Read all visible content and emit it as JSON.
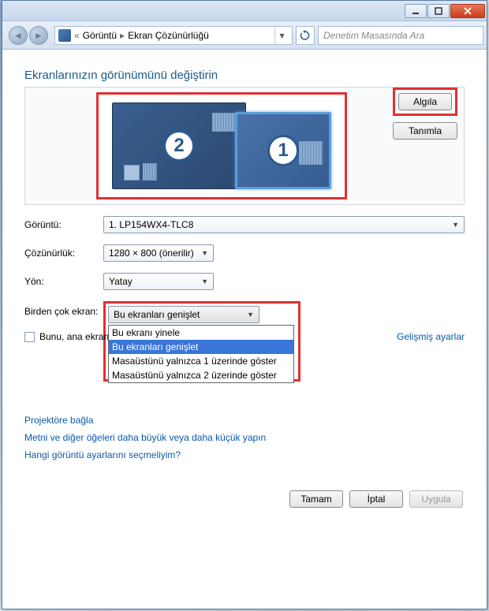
{
  "breadcrumb": {
    "item1": "Görüntü",
    "item2": "Ekran Çözünürlüğü"
  },
  "search": {
    "placeholder": "Denetim Masasında Ara"
  },
  "page": {
    "title": "Ekranlarınızın görünümünü değiştirin"
  },
  "monitors": {
    "num1": "1",
    "num2": "2"
  },
  "buttons": {
    "detect": "Algıla",
    "identify": "Tanımla",
    "ok": "Tamam",
    "cancel": "İptal",
    "apply": "Uygula"
  },
  "labels": {
    "display": "Görüntü:",
    "resolution": "Çözünürlük:",
    "orientation": "Yön:",
    "multiple": "Birden çok ekran:",
    "primary": "Bunu, ana ekran",
    "advanced": "Gelişmiş ayarlar"
  },
  "selects": {
    "display_value": "1. LP154WX4-TLC8",
    "resolution_value": "1280 × 800 (önerilir)",
    "orientation_value": "Yatay",
    "multiple_value": "Bu ekranları genişlet"
  },
  "dropdown": {
    "opt0": "Bu ekranı yinele",
    "opt1": "Bu ekranları genişlet",
    "opt2": "Masaüstünü yalnızca 1 üzerinde göster",
    "opt3": "Masaüstünü yalnızca 2 üzerinde göster"
  },
  "links": {
    "projector": "Projektöre bağla",
    "text_size": "Metni ve diğer öğeleri daha büyük veya daha küçük yapın",
    "which": "Hangi görüntü ayarlarını seçmeliyim?"
  }
}
